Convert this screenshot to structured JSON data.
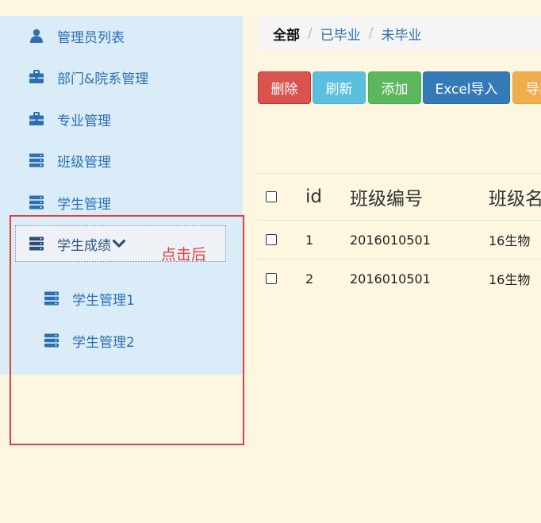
{
  "sidebar": {
    "items": [
      {
        "label": "管理员列表",
        "icon": "user-icon"
      },
      {
        "label": "部门&院系管理",
        "icon": "briefcase-icon"
      },
      {
        "label": "专业管理",
        "icon": "briefcase-icon"
      },
      {
        "label": "班级管理",
        "icon": "server-icon"
      },
      {
        "label": "学生管理",
        "icon": "server-icon"
      }
    ],
    "active": {
      "label": "学生成绩",
      "icon": "server-icon",
      "expanded_icon": "chevron-down-icon"
    },
    "subitems": [
      {
        "label": "学生管理1",
        "icon": "server-icon"
      },
      {
        "label": "学生管理2",
        "icon": "server-icon"
      }
    ]
  },
  "annotation": {
    "text": "点击后",
    "color": "#e0403f"
  },
  "breadcrumb": {
    "current": "全部",
    "links": [
      "已毕业",
      "未毕业"
    ],
    "separator": "/"
  },
  "toolbar": {
    "delete": "删除",
    "refresh": "刷新",
    "add": "添加",
    "excel_import": "Excel导入",
    "export": "导出"
  },
  "table": {
    "headers": [
      "id",
      "班级编号",
      "班级名称"
    ],
    "rows": [
      [
        "1",
        "2016010501",
        "16生物"
      ],
      [
        "2",
        "2016010501",
        "16生物"
      ]
    ]
  },
  "colors": {
    "sidebar_bg": "#d9ecf7",
    "page_bg": "#fdf7e1",
    "link": "#2d6fb2",
    "danger": "#d9534f",
    "info": "#5bc0de",
    "success": "#5cb85c",
    "primary": "#337ab7",
    "warning": "#f0ad4e"
  }
}
